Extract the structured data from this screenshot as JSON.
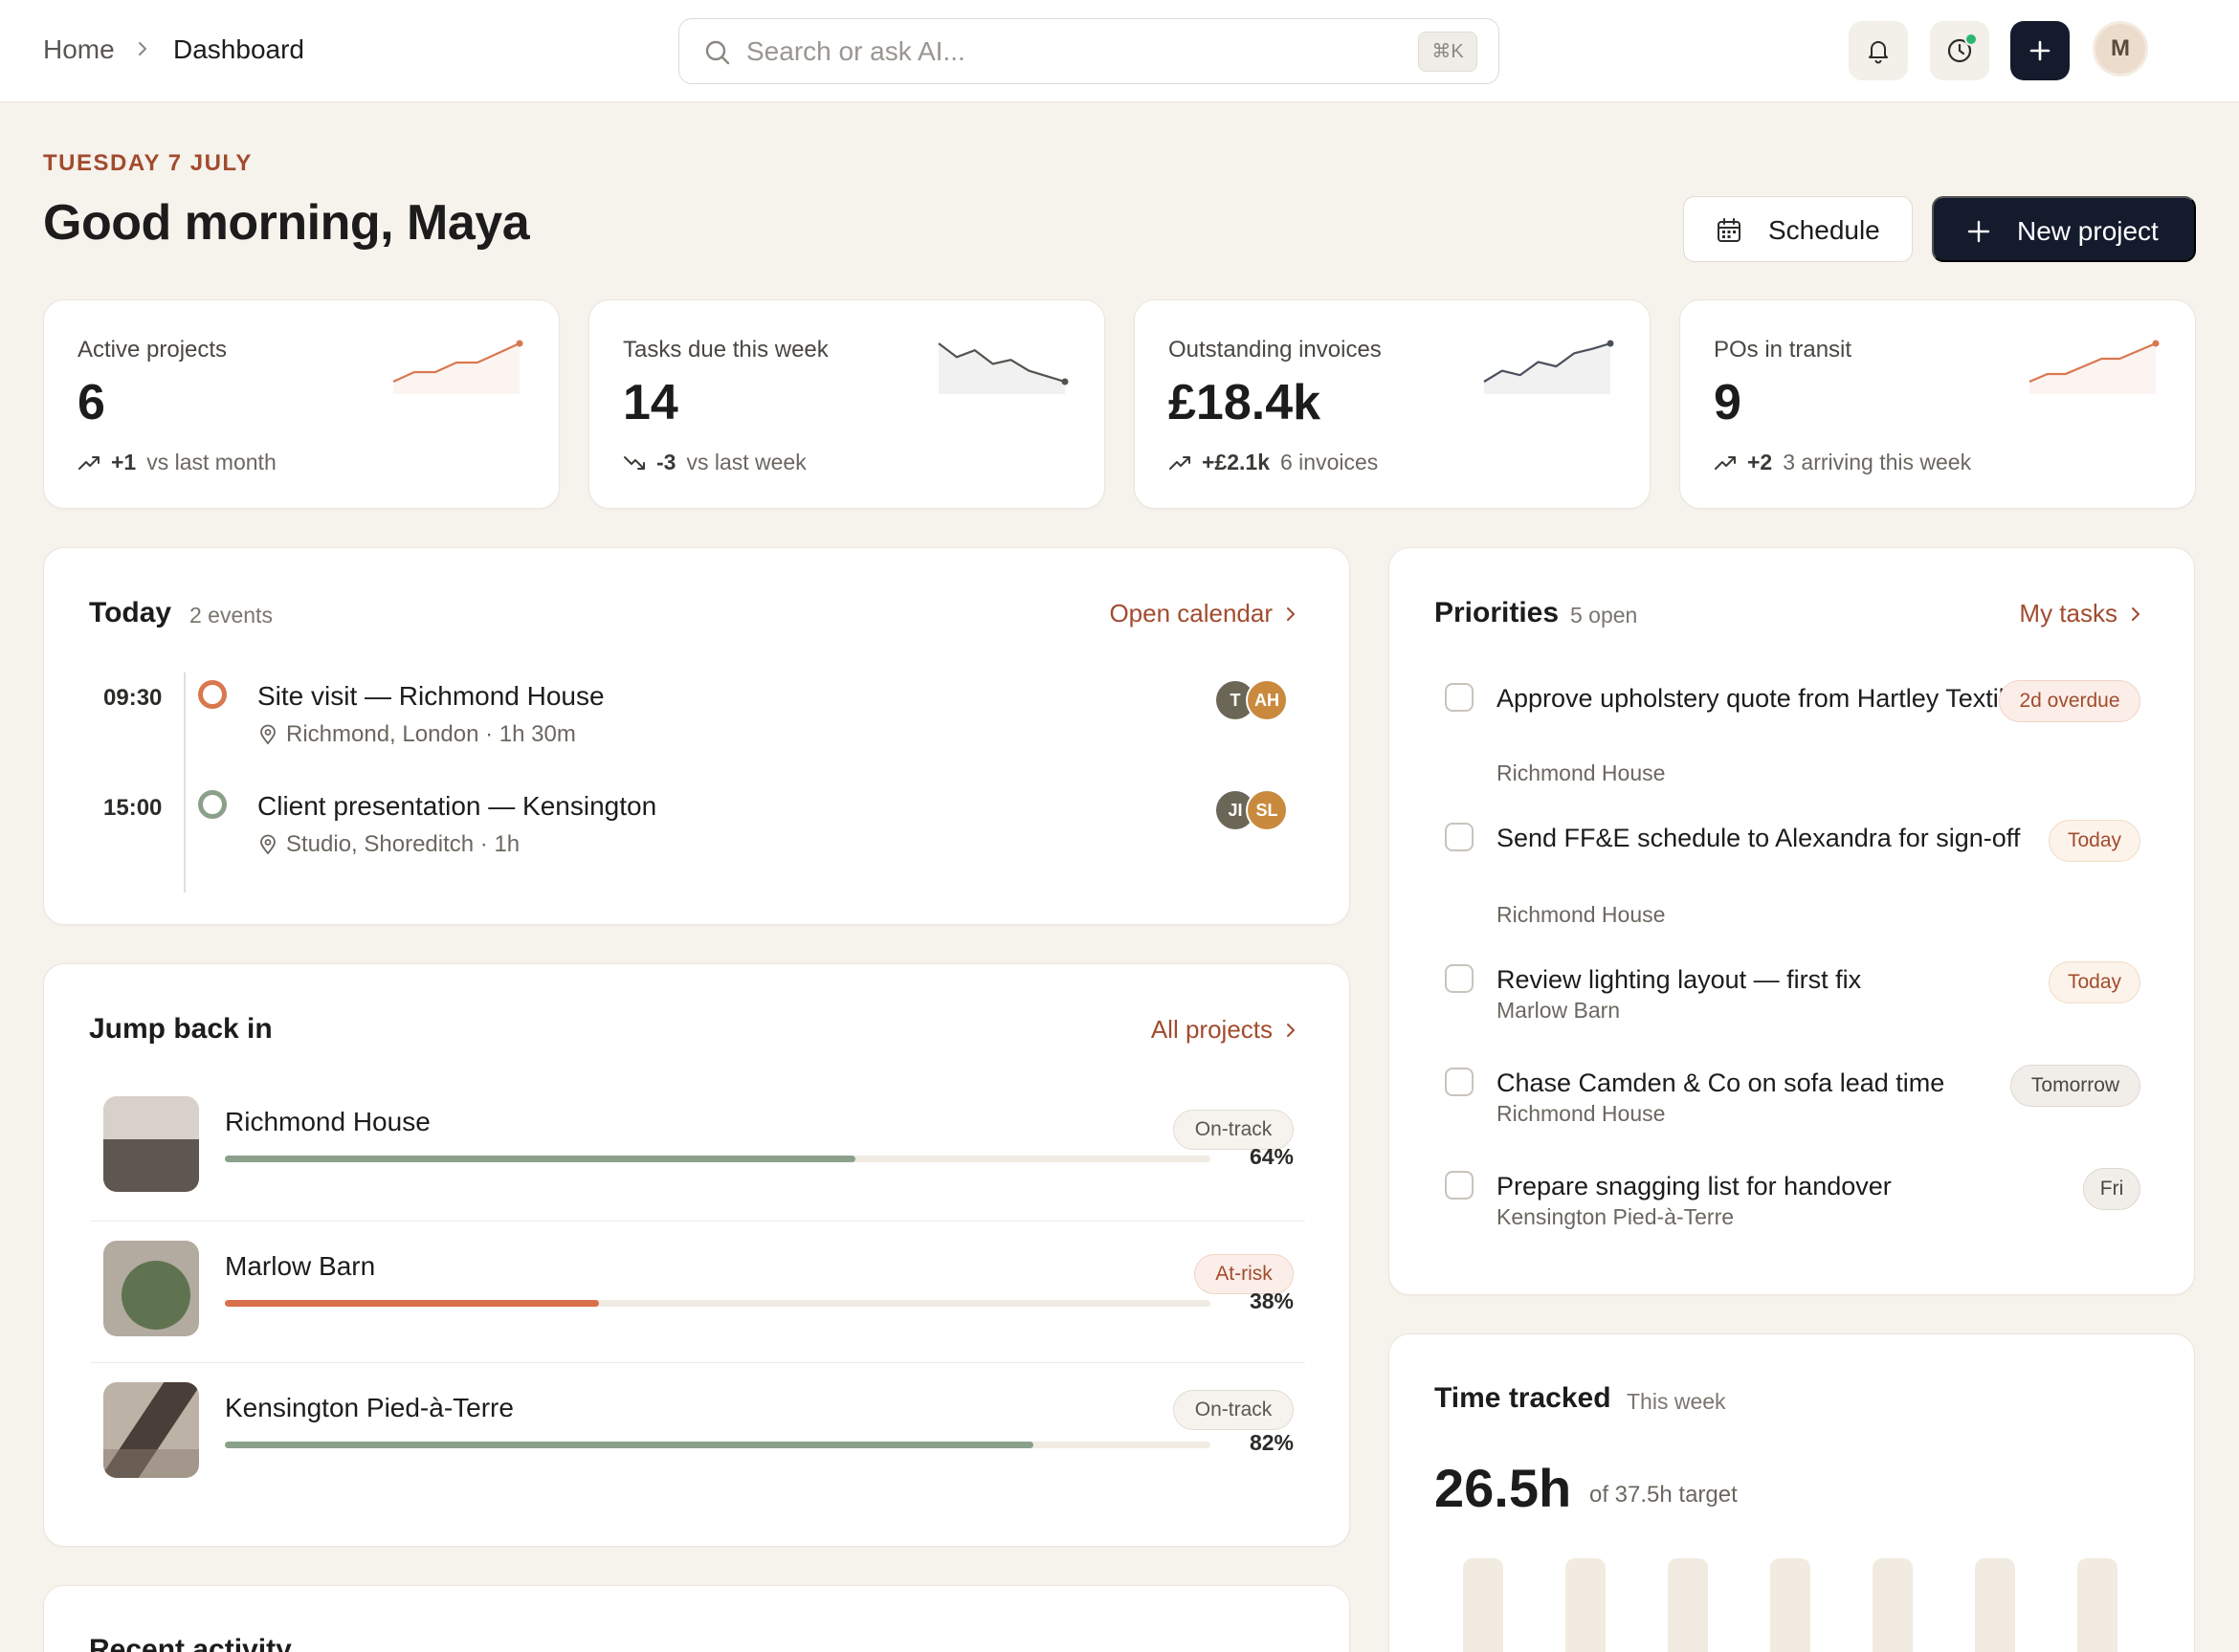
{
  "breadcrumb": {
    "home": "Home",
    "current": "Dashboard"
  },
  "search": {
    "placeholder": "Search or ask AI...",
    "shortcut": "⌘K"
  },
  "header_icons": [
    "bell-icon",
    "clock-icon",
    "plus-icon"
  ],
  "user": {
    "initial": "M"
  },
  "greeting": {
    "date": "TUESDAY 7 JULY",
    "title": "Good morning, Maya"
  },
  "actions": {
    "schedule": "Schedule",
    "new_project": "New project"
  },
  "stats": [
    {
      "label": "Active projects",
      "value": "6",
      "delta": "+1",
      "delta_text": "vs last month",
      "trend": "up",
      "spark": [
        2,
        3,
        3,
        4,
        4,
        5,
        6
      ]
    },
    {
      "label": "Tasks due this week",
      "value": "14",
      "delta": "-3",
      "delta_text": "vs last week",
      "trend": "down",
      "spark": [
        6,
        5,
        5.5,
        4.5,
        4.8,
        4,
        3.6,
        3.2
      ]
    },
    {
      "label": "Outstanding invoices",
      "value": "£18.4k",
      "delta": "+£2.1k",
      "delta_text": "6 invoices",
      "trend": "up",
      "spark": [
        2,
        3,
        2.6,
        3.8,
        3.4,
        4.6,
        5,
        5.5
      ]
    },
    {
      "label": "POs in transit",
      "value": "9",
      "delta": "+2",
      "delta_text": "3 arriving this week",
      "trend": "up",
      "spark": [
        2,
        2.8,
        2.8,
        3.6,
        4.4,
        4.4,
        5.2,
        6
      ]
    }
  ],
  "today": {
    "title": "Today",
    "count": "2 events",
    "link": "Open calendar",
    "events": [
      {
        "time": "09:30",
        "title": "Site visit — Richmond House",
        "location": "Richmond, London · 1h 30m",
        "avatars": [
          "T",
          "AH"
        ]
      },
      {
        "time": "15:00",
        "title": "Client presentation — Kensington",
        "location": "Studio, Shoreditch · 1h",
        "avatars": [
          "JI",
          "SL"
        ]
      }
    ]
  },
  "jump": {
    "title": "Jump back in",
    "link": "All projects",
    "projects": [
      {
        "name": "Richmond House",
        "status": "On-track",
        "progress": 64,
        "progress_label": "64%"
      },
      {
        "name": "Marlow Barn",
        "status": "At-risk",
        "progress": 38,
        "progress_label": "38%"
      },
      {
        "name": "Kensington Pied-à-Terre",
        "status": "On-track",
        "progress": 82,
        "progress_label": "82%"
      }
    ]
  },
  "recent": {
    "title": "Recent activity"
  },
  "priorities": {
    "title": "Priorities",
    "count": "5 open",
    "link": "My tasks",
    "tasks": [
      {
        "title": "Approve upholstery quote from Hartley Textiles",
        "project": "Richmond House",
        "due": "2d overdue"
      },
      {
        "title": "Send FF&E schedule to Alexandra for sign-off",
        "project": "Richmond House",
        "due": "Today"
      },
      {
        "title": "Review lighting layout — first fix",
        "project": "Marlow Barn",
        "due": "Today"
      },
      {
        "title": "Chase Camden & Co on sofa lead time",
        "project": "Richmond House",
        "due": "Tomorrow"
      },
      {
        "title": "Prepare snagging list for handover",
        "project": "Kensington Pied-à-Terre",
        "due": "Fri"
      }
    ]
  },
  "time_tracked": {
    "title": "Time tracked",
    "period": "This week",
    "value": "26.5h",
    "target": "of 37.5h target"
  },
  "colors": {
    "accent": "#a24b2e",
    "primary_button": "#141b2d",
    "on_track": "#8aa08a",
    "at_risk": "#d9704d",
    "background": "#f6f2ec"
  }
}
